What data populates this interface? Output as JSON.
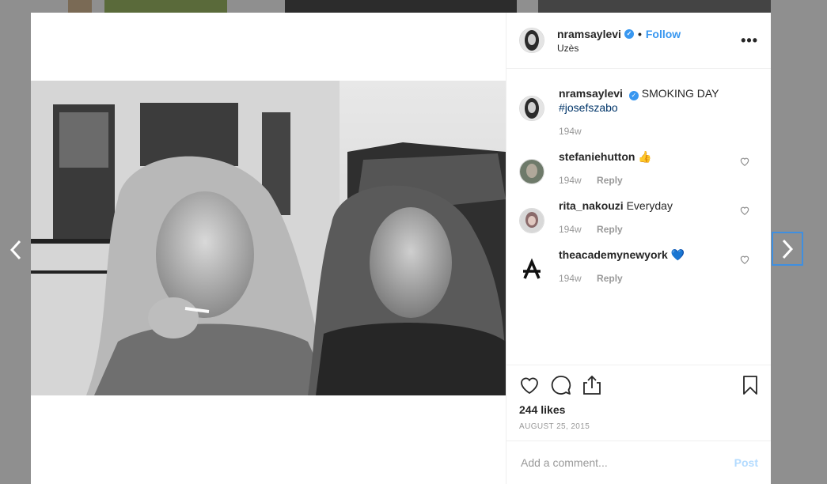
{
  "post": {
    "username": "nramsaylevi",
    "follow_label": "Follow",
    "location": "Uzès",
    "more_label": "•••"
  },
  "comments": [
    {
      "username": "nramsaylevi",
      "text": "SMOKING DAY",
      "hashtag": "#josefszabo",
      "age": "194w",
      "reply": ""
    },
    {
      "username": "stefaniehutton",
      "text": "👍",
      "age": "194w",
      "reply": "Reply"
    },
    {
      "username": "rita_nakouzi",
      "text": "Everyday",
      "age": "194w",
      "reply": "Reply"
    },
    {
      "username": "theacademynewyork",
      "text": "💙",
      "age": "194w",
      "reply": "Reply"
    }
  ],
  "stats": {
    "likes": "244 likes",
    "date": "AUGUST 25, 2015"
  },
  "composer": {
    "placeholder": "Add a comment...",
    "post_label": "Post"
  },
  "icons": {
    "verified": "verified-badge-icon",
    "like": "heart-icon",
    "comment": "comment-bubble-icon",
    "share": "share-icon",
    "save": "bookmark-icon",
    "prev": "chevron-left-icon",
    "next": "chevron-right-icon"
  },
  "colors": {
    "accent": "#3897f0",
    "backdrop": "#8f8f8f",
    "hashtag": "#003569",
    "muted": "#999999"
  }
}
